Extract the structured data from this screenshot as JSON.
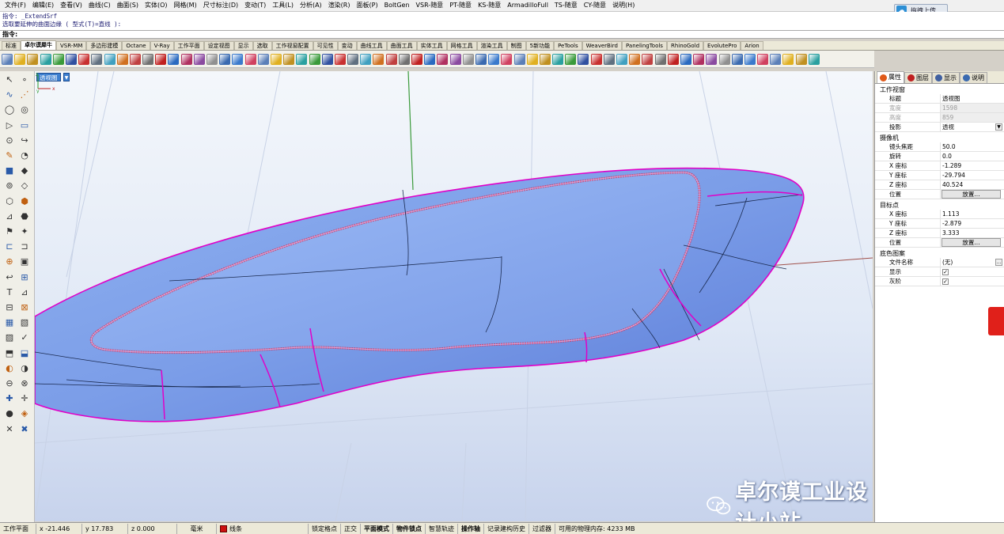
{
  "menu": [
    "文件(F)",
    "编辑(E)",
    "查看(V)",
    "曲线(C)",
    "曲面(S)",
    "实体(O)",
    "网格(M)",
    "尺寸标注(D)",
    "变动(T)",
    "工具(L)",
    "分析(A)",
    "渲染(R)",
    "面板(P)",
    "BoltGen",
    "VSR-随意",
    "PT-随意",
    "KS-随意",
    "ArmadilloFull",
    "TS-随意",
    "CY-随意",
    "说明(H)"
  ],
  "upload_button": "拖拽上传",
  "command": {
    "history": [
      "指令: _ExtendSrf",
      "选取要延伸的曲面边缘 ( 型式(T)=直线 ):"
    ],
    "prompt": "指令:"
  },
  "tabs": [
    "标准",
    "卓尔谟犀牛",
    "VSR-MM",
    "多边形建模",
    "Octane",
    "V-Ray",
    "工作平面",
    "设定视图",
    "显示",
    "选取",
    "工作视窗配置",
    "可见性",
    "变动",
    "曲线工具",
    "曲面工具",
    "实体工具",
    "网格工具",
    "渲染工具",
    "制图",
    "5新功能",
    "PeTools",
    "WeaverBird",
    "PanelingTools",
    "RhinoGold",
    "EvolutePro",
    "Arion"
  ],
  "active_tab_index": 1,
  "viewport": {
    "title": "透视图",
    "axis_labels": [
      "x",
      "y",
      "z"
    ]
  },
  "watermark": "卓尔谟工业设计小站",
  "panel": {
    "tabs": [
      {
        "label": "属性",
        "icon": "properties-icon",
        "color": "#e05a1a"
      },
      {
        "label": "图层",
        "icon": "layers-icon",
        "color": "#c02020"
      },
      {
        "label": "显示",
        "icon": "display-icon",
        "color": "#4060a0"
      },
      {
        "label": "说明",
        "icon": "help-icon",
        "color": "#3a6ab0"
      }
    ],
    "viewport_section": "工作视窗",
    "viewport_rows": [
      [
        "标题",
        "透视图"
      ],
      [
        "宽度",
        "1598"
      ],
      [
        "高度",
        "859"
      ],
      [
        "投影",
        "透视"
      ]
    ],
    "camera_section": "摄像机",
    "camera_rows": [
      [
        "镜头焦距",
        "50.0"
      ],
      [
        "旋转",
        "0.0"
      ],
      [
        "X 座标",
        "-1.289"
      ],
      [
        "Y 座标",
        "-29.794"
      ],
      [
        "Z 座标",
        "40.524"
      ],
      [
        "位置",
        "放置..."
      ]
    ],
    "target_section": "目标点",
    "target_rows": [
      [
        "X 座标",
        "1.113"
      ],
      [
        "Y 座标",
        "-2.879"
      ],
      [
        "Z 座标",
        "3.333"
      ],
      [
        "位置",
        "放置..."
      ]
    ],
    "background_section": "底色图案",
    "background_rows": [
      [
        "文件名称",
        "(无)"
      ],
      [
        "显示",
        "✓"
      ],
      [
        "灰阶",
        "✓"
      ]
    ]
  },
  "status": {
    "cplane": "工作平面",
    "x": "x -21.446",
    "y": "y 17.783",
    "z": "z 0.000",
    "units": "毫米",
    "layer": "线条",
    "layer_color": "#cc1010",
    "toggles": [
      "锁定格点",
      "正交",
      "平面模式",
      "物件锁点",
      "智慧轨迹",
      "操作轴",
      "记录建构历史",
      "过滤器"
    ],
    "memory": "可用的物理内存: 4233 MB"
  }
}
